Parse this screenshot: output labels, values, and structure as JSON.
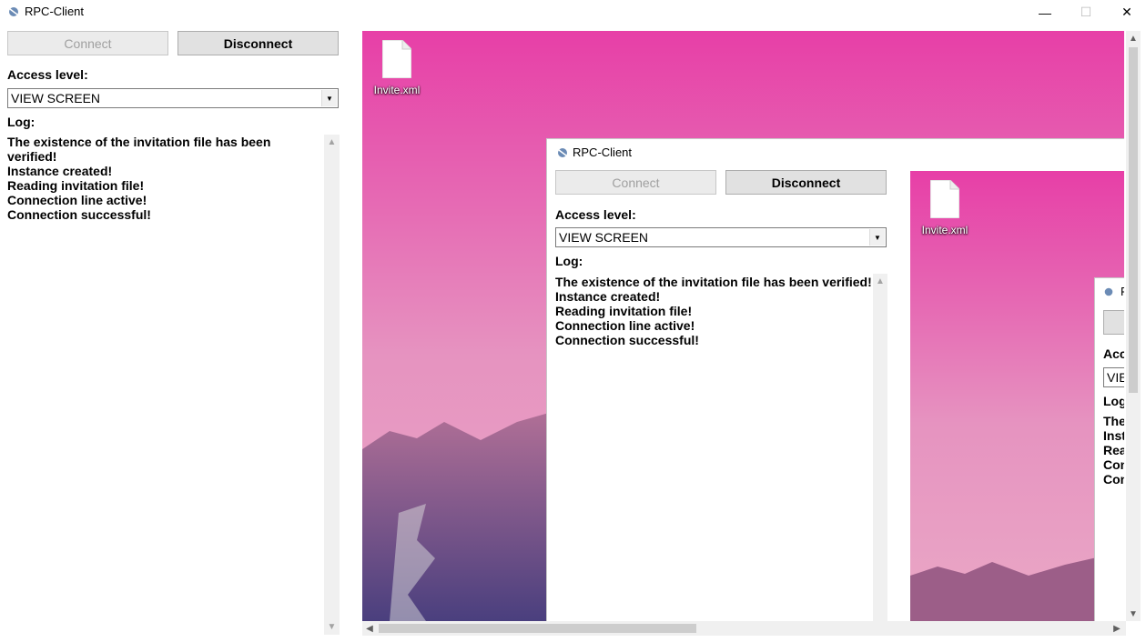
{
  "window": {
    "title": "RPC-Client",
    "caption": {
      "minimize": "—",
      "maximize": "☐",
      "close": "✕"
    }
  },
  "controls": {
    "connect_label": "Connect",
    "disconnect_label": "Disconnect",
    "access_label": "Access level:",
    "access_value": "VIEW SCREEN",
    "log_label": "Log:"
  },
  "log_lines": [
    "The existence of the invitation file has been verified!",
    "Instance created!",
    "Reading invitation file!",
    "Connection line active!",
    "Connection successful!"
  ],
  "remote_view": {
    "desktop_icon_label": "Invite.xml",
    "nested_title": "RPC-Client",
    "nested2_truncated": {
      "title": "R",
      "access_label": "Acc",
      "access_value": "VIE",
      "log_label": "Log",
      "lines": [
        "The",
        "Inst",
        "Rea",
        "Con",
        "Con"
      ]
    }
  },
  "colors": {
    "desktop_top": "#e73fa7",
    "desktop_bottom": "#eaa9c6",
    "mountain": "#8a4d7a"
  }
}
